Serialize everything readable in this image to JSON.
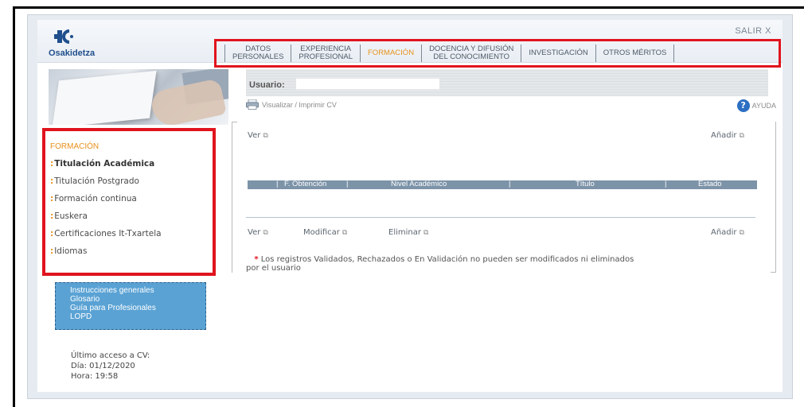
{
  "header": {
    "logo_text": "Osakidetza",
    "logout_label": "SALIR X",
    "nav": [
      {
        "line1": "DATOS",
        "line2": "PERSONALES",
        "active": false
      },
      {
        "line1": "EXPERIENCIA",
        "line2": "PROFESIONAL",
        "active": false
      },
      {
        "line1": "FORMACIÓN",
        "line2": "",
        "active": true
      },
      {
        "line1": "DOCENCIA Y DIFUSIÓN",
        "line2": "DEL CONOCIMIENTO",
        "active": false
      },
      {
        "line1": "INVESTIGACIÓN",
        "line2": "",
        "active": false
      },
      {
        "line1": "OTROS MÉRITOS",
        "line2": "",
        "active": false
      }
    ]
  },
  "sidebar": {
    "title": "FORMACIÓN",
    "bullet": ":",
    "items": [
      {
        "label": "Titulación Académica",
        "active": true
      },
      {
        "label": "Titulación Postgrado",
        "active": false
      },
      {
        "label": "Formación continua",
        "active": false
      },
      {
        "label": "Euskera",
        "active": false
      },
      {
        "label": "Certificaciones It-Txartela",
        "active": false
      },
      {
        "label": "Idiomas",
        "active": false
      }
    ],
    "help_links": [
      "Instrucciones generales",
      "Glosario",
      "Guía para Profesionales",
      "LOPD"
    ],
    "last_access": {
      "title": "Último acceso a CV:",
      "day": "Día: 01/12/2020",
      "time": "Hora: 19:58"
    }
  },
  "main": {
    "user_label": "Usuario:",
    "user_value": "",
    "print_label": "Visualizar / Imprimir CV",
    "help_label": "AYUDA",
    "top_actions": {
      "view": "Ver",
      "add": "Añadir"
    },
    "table_columns": [
      "F. Obtención",
      "Nivel Académico",
      "Título",
      "Estado"
    ],
    "bottom_actions": {
      "view": "Ver",
      "modify": "Modificar",
      "delete": "Eliminar",
      "add": "Añadir"
    },
    "note_star": "*",
    "note": "Los registros Validados, Rechazados o En Validación no pueden ser modificados ni eliminados",
    "note_line2": "por el usuario"
  },
  "colors": {
    "accent_orange": "#e8911c",
    "highlight_red": "#e0141e",
    "table_header": "#7c93a8",
    "help_box": "#5aa2d4",
    "brand_blue": "#1f4f8c"
  },
  "icons": [
    "osakidetza-logo",
    "printer-icon",
    "help-icon",
    "external-link-icon"
  ]
}
